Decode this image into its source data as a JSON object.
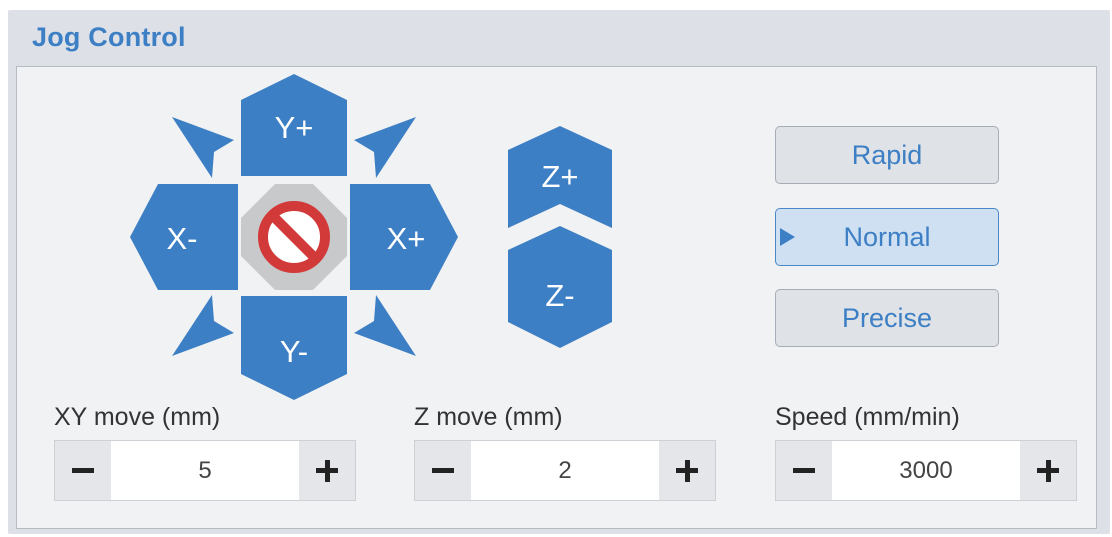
{
  "panel": {
    "title": "Jog Control"
  },
  "jog": {
    "y_plus": "Y+",
    "y_minus": "Y-",
    "x_plus": "X+",
    "x_minus": "X-",
    "z_plus": "Z+",
    "z_minus": "Z-",
    "stop_icon": "stop-prohibited-icon",
    "diagonal_icon": "diagonal-arrow-icon"
  },
  "speed_modes": {
    "options": [
      "Rapid",
      "Normal",
      "Precise"
    ],
    "selected": "Normal"
  },
  "xy_move": {
    "label": "XY move (mm)",
    "value": "5"
  },
  "z_move": {
    "label": "Z move (mm)",
    "value": "2"
  },
  "speed": {
    "label": "Speed (mm/min)",
    "value": "3000"
  },
  "colors": {
    "accent": "#3d7fc4",
    "panel_bg": "#dde1e7",
    "inner_bg": "#f1f2f4",
    "stop_red": "#d23a3a",
    "stop_octagon": "#c8c9cb"
  }
}
